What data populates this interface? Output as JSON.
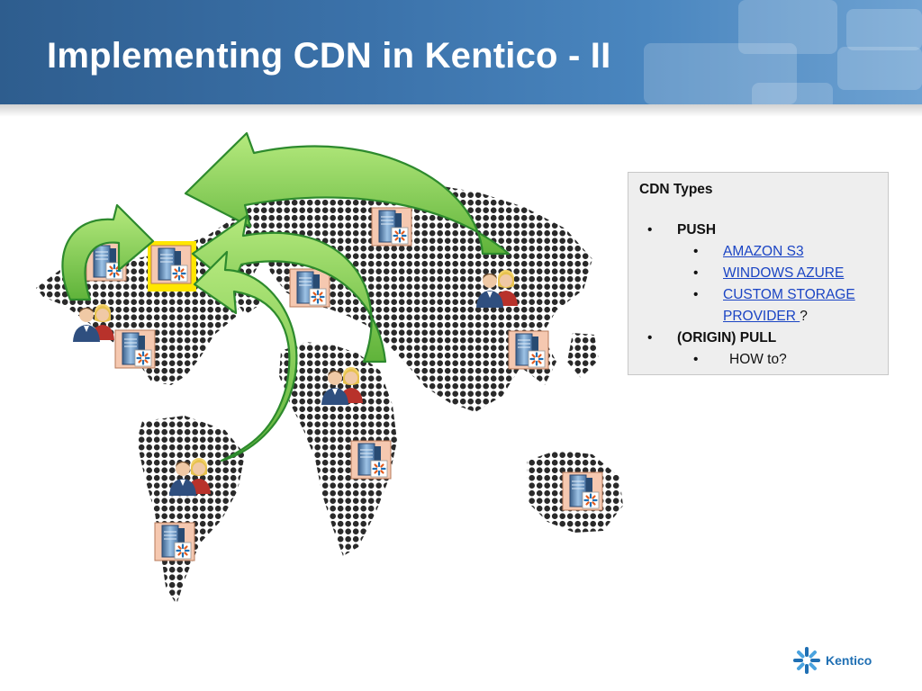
{
  "slide": {
    "title": "Implementing CDN in Kentico - II"
  },
  "cdn_box": {
    "heading": "CDN Types",
    "push_label": "PUSH",
    "push_items": [
      "AMAZON S3",
      "WINDOWS AZURE",
      "CUSTOM STORAGE PROVIDER "
    ],
    "push_suffix": "?",
    "pull_label": "(ORIGIN) PULL",
    "pull_items": [
      "HOW to?"
    ]
  },
  "logo": {
    "text": "Kentico"
  },
  "colors": {
    "header": "#3b72aa",
    "arrow_fill": "#8fd05a",
    "arrow_border": "#2d8a2d",
    "server_bg": "#f5c8b0",
    "origin_highlight": "#ffe600",
    "link": "#1a44c4",
    "kentico": "#1f6fb3"
  },
  "icons": [
    "server-icon",
    "users-icon",
    "kentico-flower-icon",
    "world-map"
  ]
}
